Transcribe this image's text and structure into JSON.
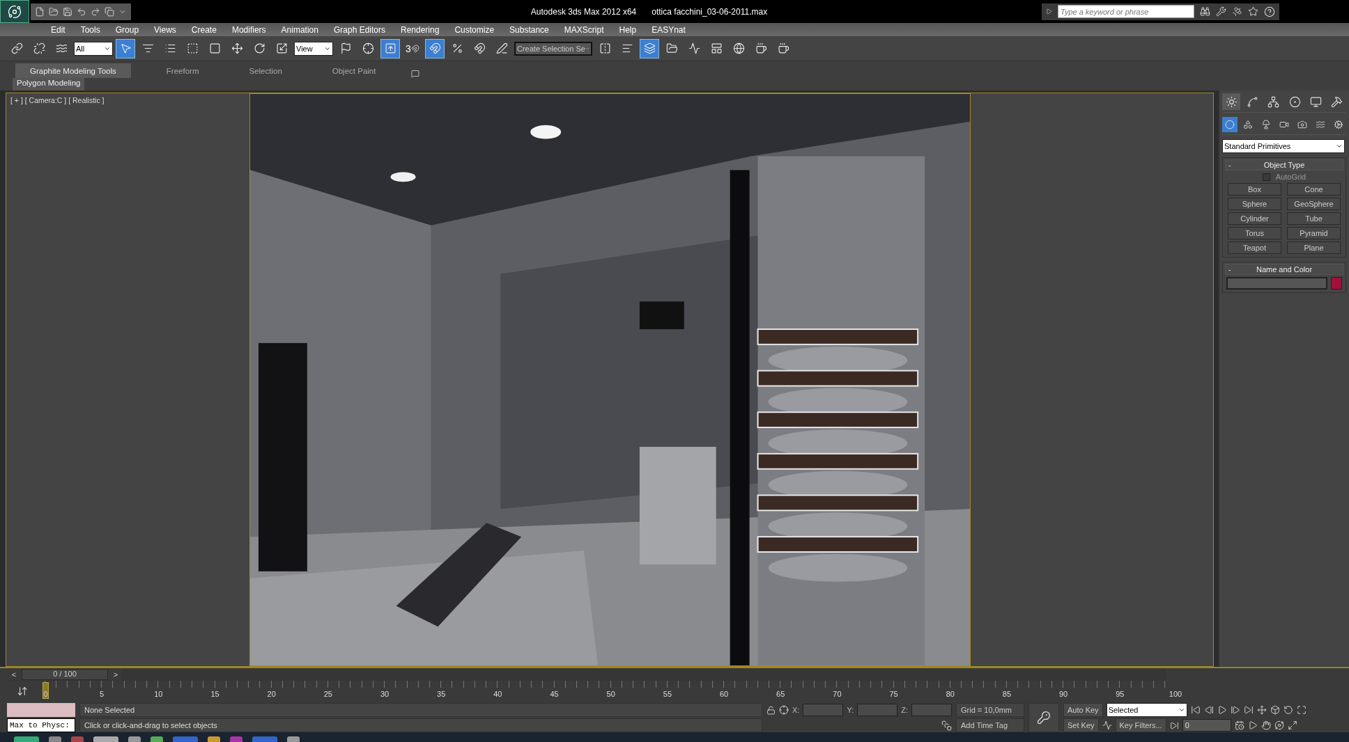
{
  "app_title": "Autodesk 3ds Max  2012 x64",
  "file_name": "ottica facchini_03-06-2011.max",
  "search": {
    "placeholder": "Type a keyword or phrase"
  },
  "menu": [
    "Edit",
    "Tools",
    "Group",
    "Views",
    "Create",
    "Modifiers",
    "Animation",
    "Graph Editors",
    "Rendering",
    "Customize",
    "Substance",
    "MAXScript",
    "Help",
    "EASYnat"
  ],
  "toolbar": {
    "selection_filter": "All",
    "reference_coord": "View",
    "named_selection": "Create Selection Se",
    "snap_number": "3",
    "tools": [
      {
        "selected": false
      },
      {
        "selected": false
      },
      {
        "selected": false
      },
      {
        "selected": true
      },
      {
        "selected": false
      },
      {
        "selected": false
      },
      {
        "selected": false
      },
      {
        "selected": false
      },
      {
        "selected": false
      },
      {
        "selected": false
      },
      {
        "selected": false
      },
      {
        "selected": false
      },
      {
        "selected": false
      },
      {
        "selected": true
      },
      {
        "selected": false
      },
      {
        "selected": true
      },
      {
        "selected": false
      },
      {
        "selected": false
      },
      {
        "selected": false
      },
      {
        "selected": false
      },
      {
        "selected": false
      },
      {
        "selected": true
      },
      {
        "selected": false
      },
      {
        "selected": false
      },
      {
        "selected": false
      },
      {
        "selected": false
      },
      {
        "selected": false
      },
      {
        "selected": false
      }
    ]
  },
  "ribbon_tabs": [
    {
      "label": "Graphite Modeling Tools",
      "selected": true
    },
    {
      "label": "Freeform",
      "selected": false
    },
    {
      "label": "Selection",
      "selected": false
    },
    {
      "label": "Object Paint",
      "selected": false
    }
  ],
  "ribbon_panel": "Polygon Modeling",
  "viewport_label": "[ + ] [ Camera:C ] [ Realistic ]",
  "command_panel": {
    "tabs": [
      {
        "selected": true
      },
      {
        "selected": false
      },
      {
        "selected": false
      },
      {
        "selected": false
      },
      {
        "selected": false
      },
      {
        "selected": false
      }
    ],
    "categories": [
      {
        "selected": true
      },
      {
        "selected": false
      },
      {
        "selected": false
      },
      {
        "selected": false
      },
      {
        "selected": false
      },
      {
        "selected": false
      },
      {
        "selected": false
      }
    ],
    "dropdown": "Standard Primitives",
    "object_type": {
      "toggle": "-",
      "title": "Object Type",
      "autogrid": {
        "label": "AutoGrid",
        "checked": false
      },
      "buttons": [
        "Box",
        "Cone",
        "Sphere",
        "GeoSphere",
        "Cylinder",
        "Tube",
        "Torus",
        "Pyramid",
        "Teapot",
        "Plane"
      ]
    },
    "name_and_color": {
      "toggle": "-",
      "title": "Name and Color",
      "color": "#a0103a"
    }
  },
  "time_slider": {
    "prev": "<",
    "label": "0 / 100",
    "next": ">",
    "level": 0
  },
  "ruler": {
    "current": "0",
    "labels": [
      "5",
      "10",
      "15",
      "20",
      "25",
      "30",
      "35",
      "40",
      "45",
      "50",
      "55",
      "60",
      "65",
      "70",
      "75",
      "80",
      "85",
      "90",
      "95",
      "100"
    ]
  },
  "listener": {
    "value": "Max to Physc:"
  },
  "status": {
    "selection": "None Selected",
    "prompt": "Click or click-and-drag to select objects"
  },
  "coords": [
    "X:",
    "Y:",
    "Z:"
  ],
  "grid": "Grid = 10,0mm",
  "add_time_tag": "Add Time Tag",
  "auto_key": "Auto Key",
  "set_key": "Set Key",
  "key_mode": "Selected",
  "key_filters": "Key Filters...",
  "frame": "0"
}
